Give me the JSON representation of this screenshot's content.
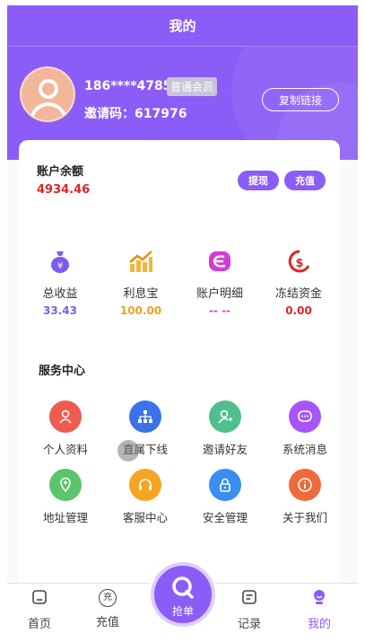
{
  "header": {
    "title": "我的"
  },
  "profile": {
    "phone": "186****4785",
    "member_level": "普通会员",
    "invite_label": "邀请码：617976",
    "copy_link_label": "复制链接"
  },
  "account": {
    "balance_label": "账户余额",
    "balance_value": "4934.46",
    "withdraw_label": "提现",
    "recharge_label": "充值"
  },
  "stats": [
    {
      "label": "总收益",
      "value": "33.43",
      "icon": "money-bag-icon",
      "color": "#7c5cf0"
    },
    {
      "label": "利息宝",
      "value": "100.00",
      "icon": "trend-chart-icon",
      "color": "#f0a020"
    },
    {
      "label": "账户明细",
      "value": "-- --",
      "icon": "account-detail-icon",
      "color": "#d43bd4"
    },
    {
      "label": "冻结资金",
      "value": "0.00",
      "icon": "frozen-funds-icon",
      "color": "#e02424"
    }
  ],
  "services": {
    "title": "服务中心",
    "items": [
      {
        "label": "个人资料",
        "icon": "user-icon",
        "color": "#ef5b4f"
      },
      {
        "label": "直属下线",
        "icon": "org-chart-icon",
        "color": "#3b72e8"
      },
      {
        "label": "邀请好友",
        "icon": "add-user-icon",
        "color": "#4fc08d"
      },
      {
        "label": "系统消息",
        "icon": "message-icon",
        "color": "#a855f7"
      },
      {
        "label": "地址管理",
        "icon": "location-icon",
        "color": "#5cc46a"
      },
      {
        "label": "客服中心",
        "icon": "support-icon",
        "color": "#f5a524"
      },
      {
        "label": "安全管理",
        "icon": "lock-icon",
        "color": "#3b8df0"
      },
      {
        "label": "关于我们",
        "icon": "info-icon",
        "color": "#f06a3a"
      }
    ]
  },
  "tabbar": {
    "home": "首页",
    "recharge": "充值",
    "grab": "抢单",
    "records": "记录",
    "mine": "我的",
    "recharge_icon_glyph": "充"
  }
}
